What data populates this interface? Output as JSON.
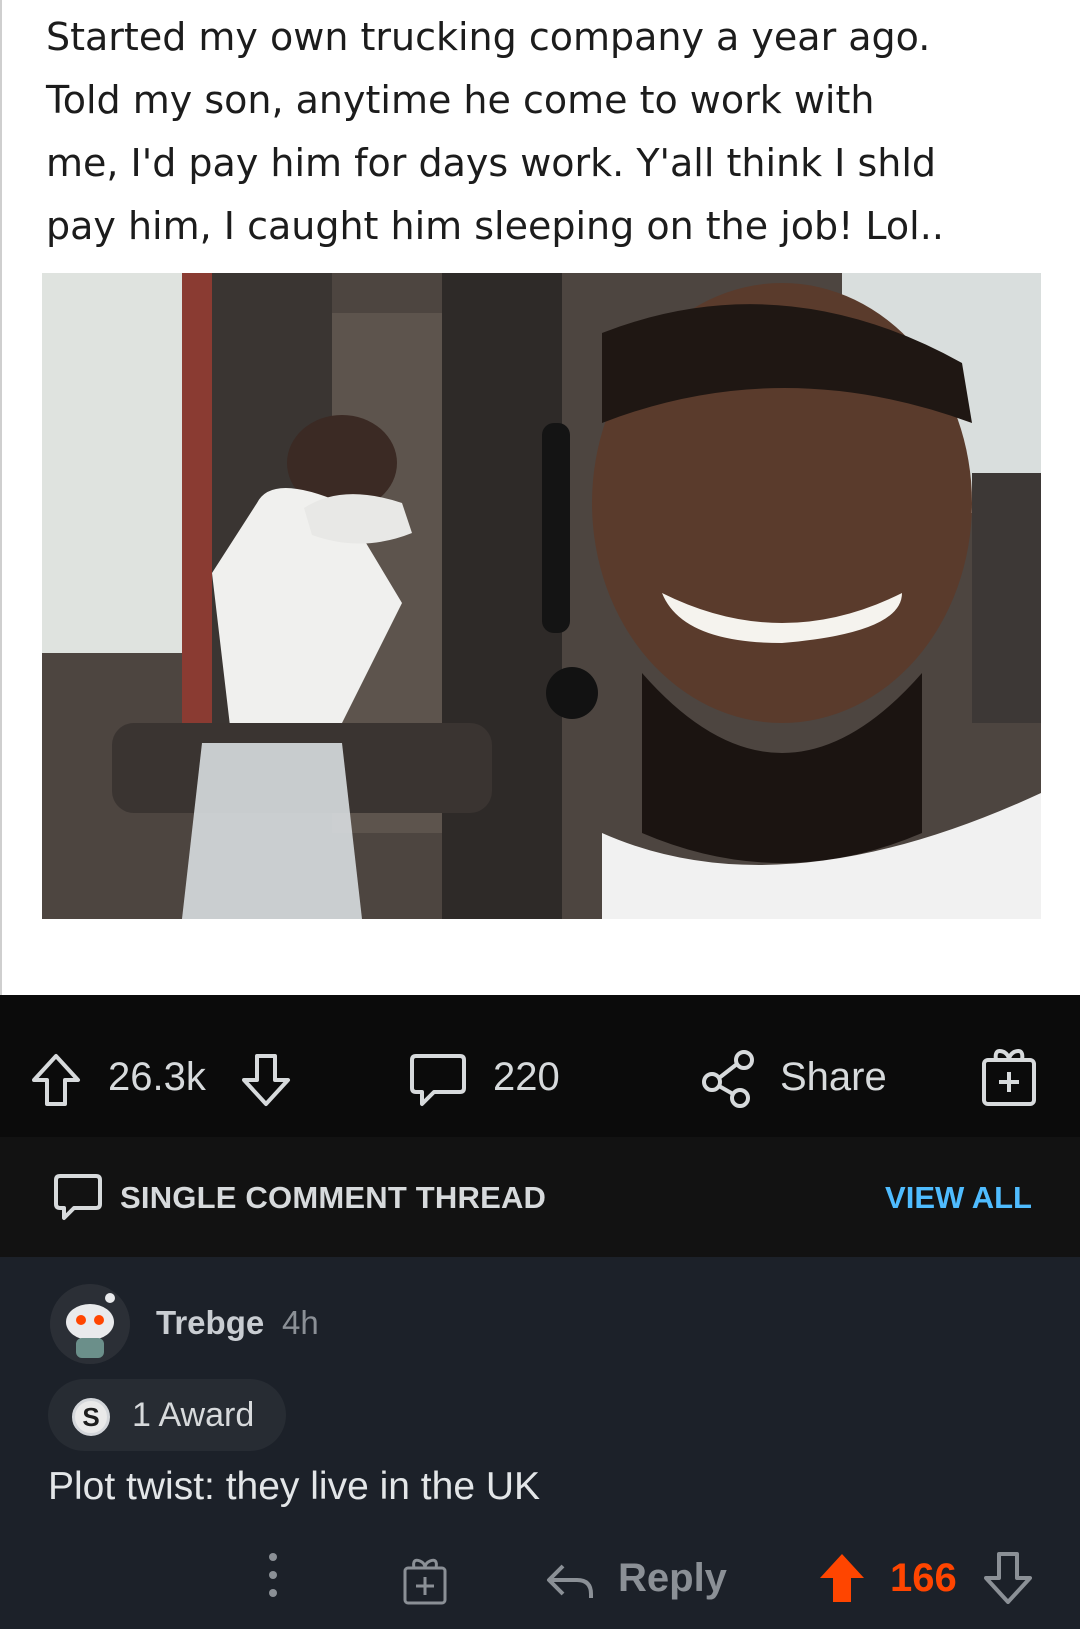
{
  "post": {
    "text": "Started my own trucking company a year ago.\nTold my son, anytime he come to work with\nme, I'd pay him for days work. Y'all think I shld\npay him, I caught him sleeping on the job! Lol..",
    "image_alt": "photo"
  },
  "actions": {
    "upvote_count": "26.3k",
    "comment_count": "220",
    "share_label": "Share"
  },
  "thread": {
    "label": "SINGLE COMMENT THREAD",
    "view_all": "VIEW ALL"
  },
  "comment": {
    "username": "Trebge",
    "time": "4h",
    "award_count_label": "1 Award",
    "body": "Plot twist: they live in the UK",
    "reply_label": "Reply",
    "score": "166"
  },
  "colors": {
    "accent_orange": "#ff4500",
    "link_blue": "#4fbcff",
    "action_bar_bg": "#0b0b0b",
    "comment_bg": "#1c2129"
  }
}
